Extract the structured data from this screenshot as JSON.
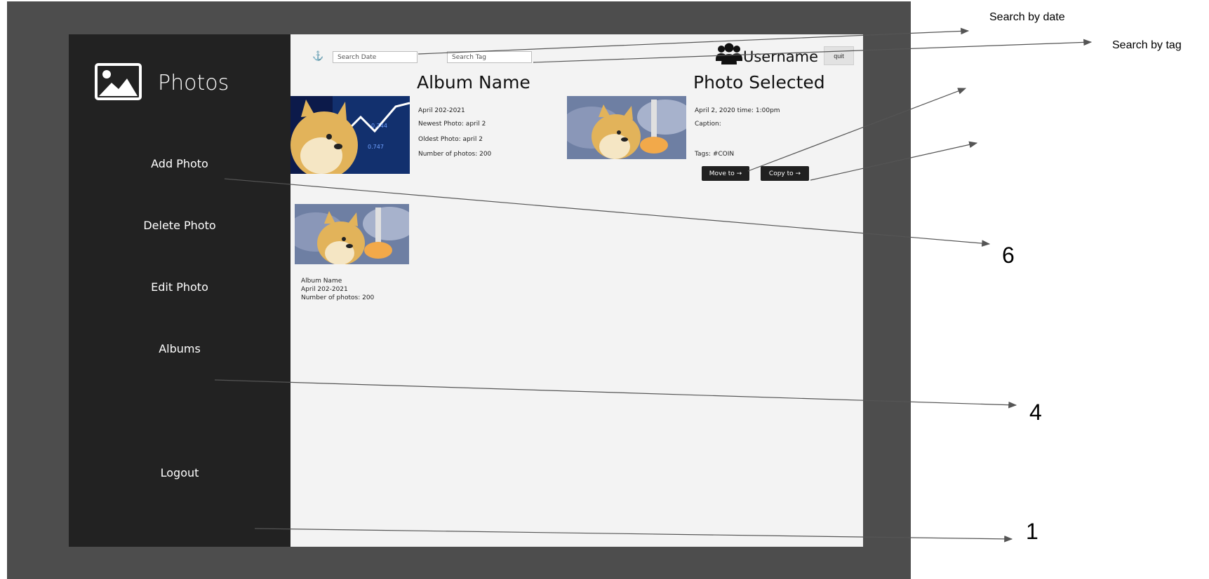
{
  "sidebar": {
    "app_title": "Photos",
    "logo_icon": "image-icon",
    "items": [
      {
        "label": "Add Photo"
      },
      {
        "label": "Delete Photo"
      },
      {
        "label": "Edit Photo"
      },
      {
        "label": "Albums"
      },
      {
        "label": "Logout"
      }
    ]
  },
  "header": {
    "download_icon": "anchor-icon",
    "search_date_placeholder": "Search Date",
    "search_tag_placeholder": "Search Tag",
    "user_icon": "users-icon",
    "username": "Username",
    "quit_label": "quit"
  },
  "album_info": {
    "title": "Album Name",
    "date_range": "April 202-2021",
    "newest": "Newest Photo: april 2",
    "oldest": "Oldest Photo: april 2",
    "count": "Number of photos: 200"
  },
  "photo_selected": {
    "title": "Photo Selected",
    "datetime": "April 2, 2020 time: 1:00pm",
    "caption": "Caption:",
    "tags": "Tags: #COIN",
    "move_label": "Move to →",
    "copy_label": "Copy to →"
  },
  "album_card": {
    "name": "Album Name",
    "date_range": "April 202-2021",
    "count": "Number of photos: 200"
  },
  "annotations": {
    "search_by_date": "Search by date",
    "search_by_tag": "Search by tag",
    "num_6": "6",
    "num_4": "4",
    "num_1": "1"
  },
  "colors": {
    "backdrop": "#4d4d4d",
    "sidebar": "#222222",
    "main_bg": "#f3f3f3",
    "button_dark": "#202020"
  }
}
